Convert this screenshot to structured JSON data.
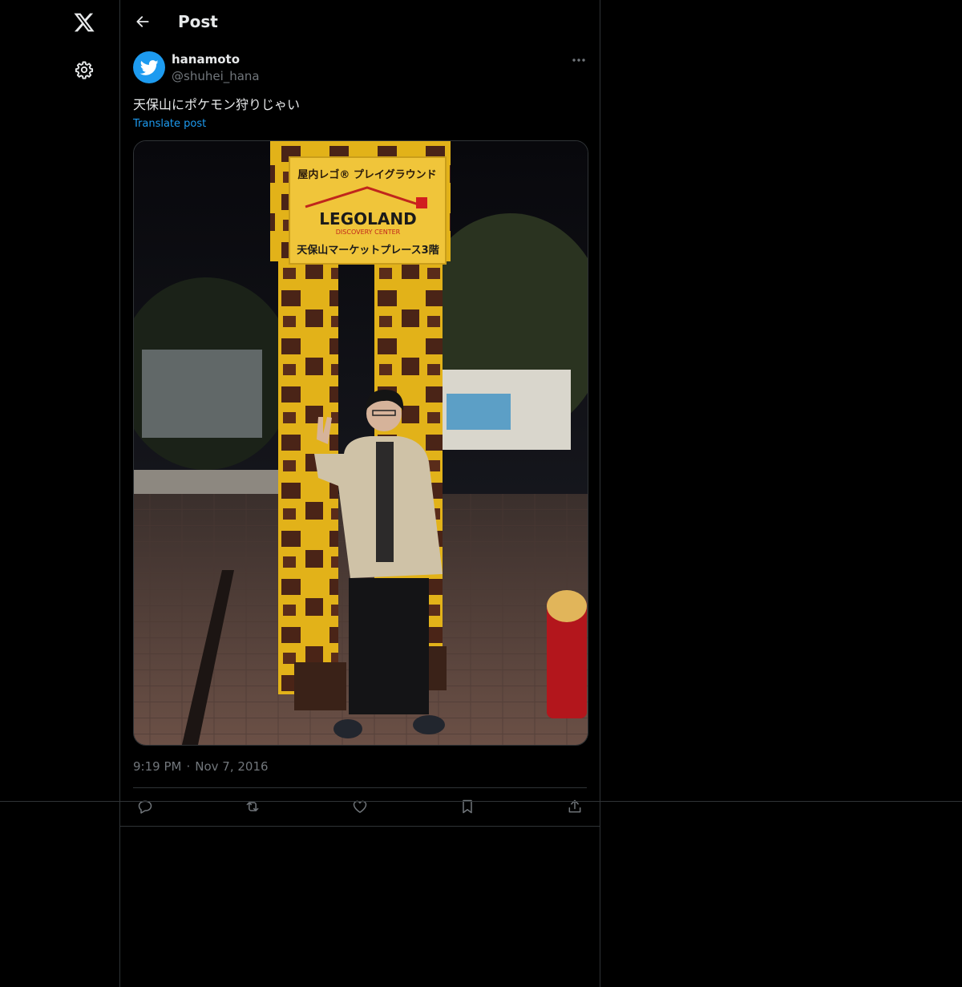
{
  "nav": {
    "logo_icon": "x-logo-icon",
    "settings_icon": "gear-icon"
  },
  "header": {
    "back_icon": "arrow-left-icon",
    "title": "Post"
  },
  "post": {
    "author": {
      "name": "hanamoto",
      "handle": "@shuhei_hana",
      "avatar_icon": "twitter-bird-icon",
      "avatar_color": "#1d9bf0"
    },
    "more_icon": "more-horizontal-icon",
    "text": "天保山にポケモン狩りじゃい",
    "translate_label": "Translate post",
    "photo": {
      "sign_line1": "屋内レゴ® プレイグラウンド",
      "sign_brand": "LEGOLAND",
      "sign_sub": "DISCOVERY CENTER",
      "sign_line3": "天保山マーケットプレース3階"
    },
    "time": "9:19 PM",
    "separator": "·",
    "date": "Nov 7, 2016",
    "actions": [
      {
        "icon": "reply-icon"
      },
      {
        "icon": "repost-icon"
      },
      {
        "icon": "like-icon"
      },
      {
        "icon": "bookmark-icon"
      },
      {
        "icon": "share-icon"
      }
    ]
  },
  "colors": {
    "background": "#000000",
    "text_primary": "#e7e9ea",
    "text_secondary": "#71767b",
    "link": "#1d9bf0",
    "border": "#2f3336"
  }
}
